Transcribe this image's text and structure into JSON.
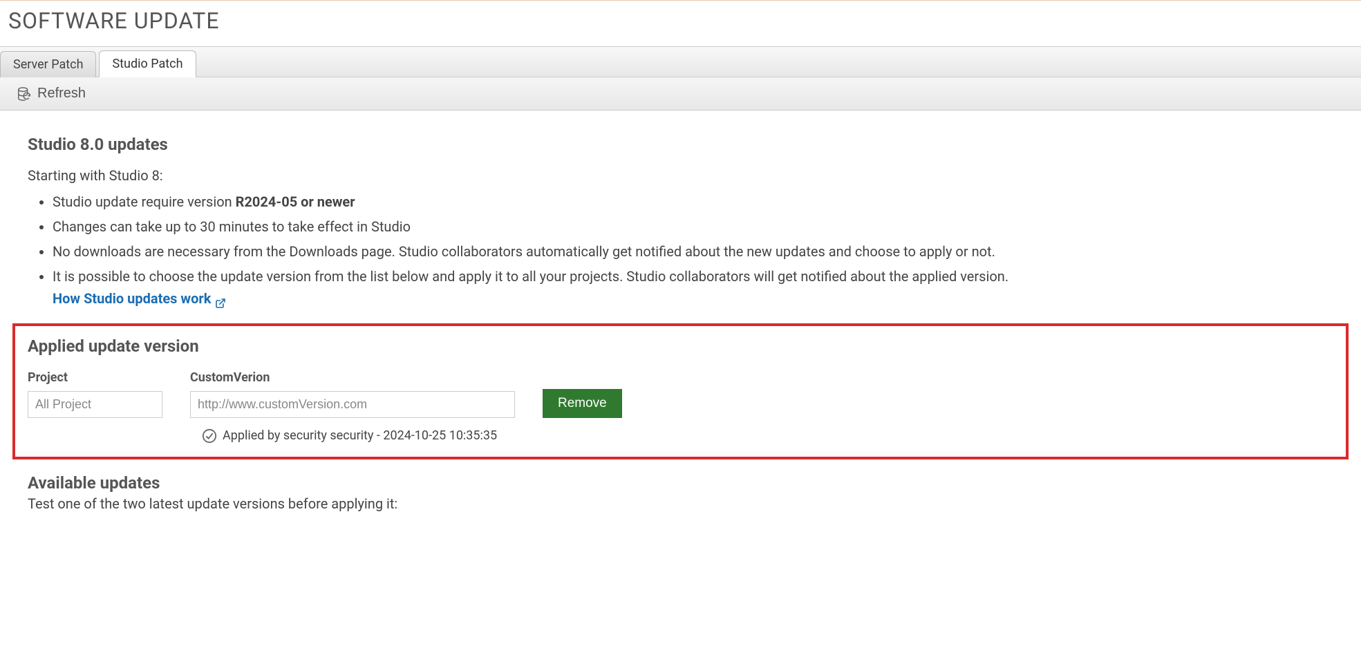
{
  "page": {
    "title": "SOFTWARE UPDATE"
  },
  "tabs": {
    "server": "Server Patch",
    "studio": "Studio Patch"
  },
  "toolbar": {
    "refresh": "Refresh"
  },
  "studio": {
    "heading": "Studio 8.0 updates",
    "intro": "Starting with Studio 8:",
    "bullets": {
      "b1_prefix": "Studio update require version ",
      "b1_bold": "R2024-05 or newer",
      "b2": "Changes can take up to 30 minutes to take effect in Studio",
      "b3": "No downloads are necessary from the Downloads page. Studio collaborators automatically get notified about the new updates and choose to apply or not.",
      "b4": "It is possible to choose the update version from the list below and apply it to all your projects. Studio collaborators will get notified about the applied version."
    },
    "link_text": "How Studio updates work"
  },
  "applied": {
    "heading": "Applied update version",
    "project_label": "Project",
    "project_value": "All Project",
    "custom_label": "CustomVerion",
    "custom_value": "http://www.customVersion.com",
    "remove_label": "Remove",
    "status_text": "Applied by security security - 2024-10-25 10:35:35"
  },
  "available": {
    "heading": "Available updates",
    "text": "Test one of the two latest update versions before applying it:"
  }
}
